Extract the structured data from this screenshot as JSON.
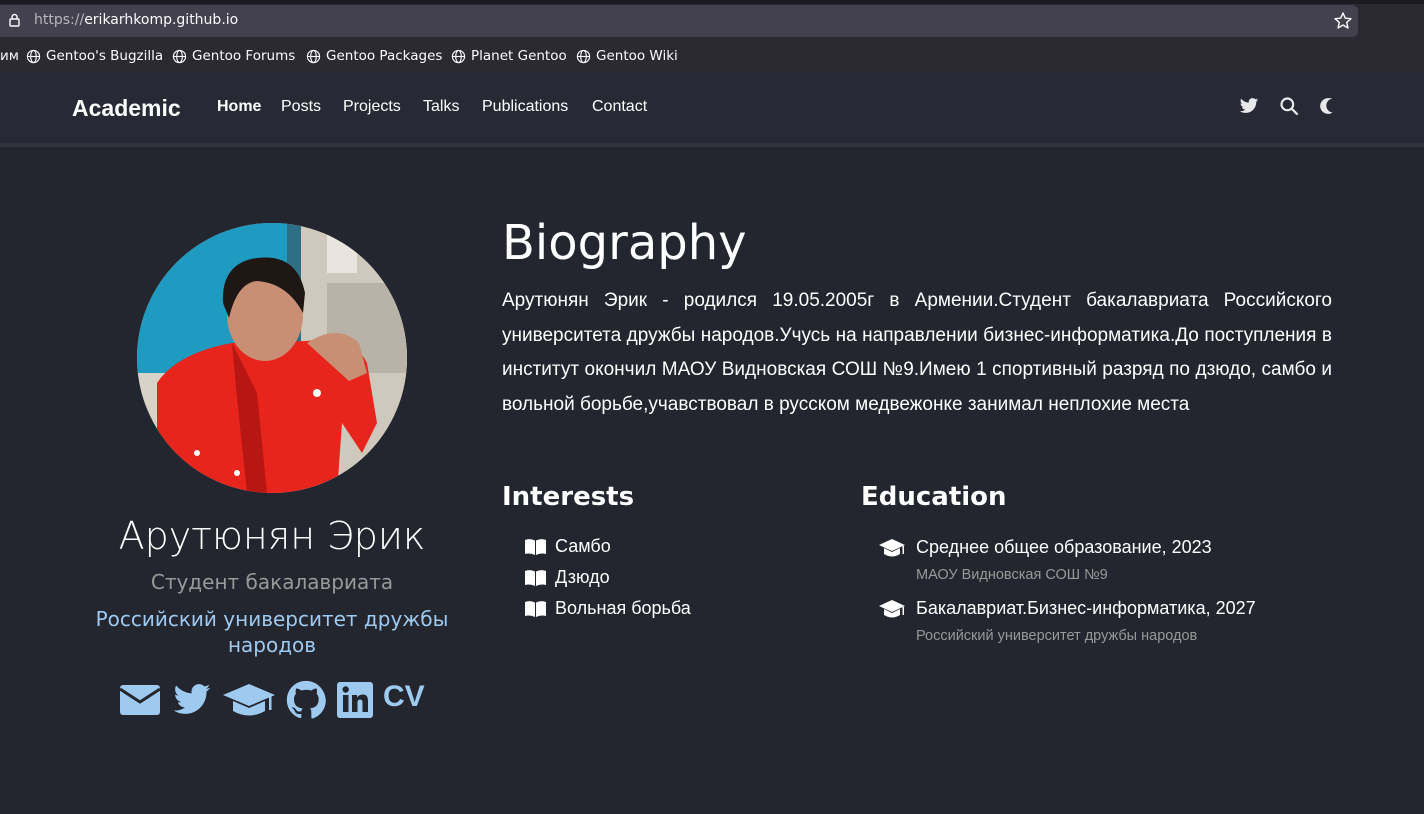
{
  "browser": {
    "url_protocol": "https://",
    "url_host": "erikarhkomp.github.io",
    "bookmarks_partial": "им",
    "bookmarks": [
      "Gentoo's Bugzilla",
      "Gentoo Forums",
      "Gentoo Packages",
      "Planet Gentoo",
      "Gentoo Wiki"
    ]
  },
  "nav": {
    "brand": "Academic",
    "links": [
      "Home",
      "Posts",
      "Projects",
      "Talks",
      "Publications",
      "Contact"
    ],
    "active": "Home"
  },
  "profile": {
    "name": "Арутюнян Эрик",
    "role": "Студент бакалавриата",
    "organization": "Российский университет дружбы народов",
    "cv_label": "CV"
  },
  "biography": {
    "title": "Biography",
    "text": "Арутюнян Эрик - родился 19.05.2005г в Армении.Студент бакалавриата Российского университета дружбы народов.Учусь на направлении бизнес-информатика.До поступления в институт окончил МАОУ Видновская СОШ №9.Имею 1 спортивный разряд по дзюдо, самбо и вольной борьбе,учавствовал в русском медвежонке занимал неплохие места"
  },
  "interests": {
    "title": "Interests",
    "items": [
      "Самбо",
      "Дзюдо",
      "Вольная борьба"
    ]
  },
  "education": {
    "title": "Education",
    "items": [
      {
        "course": "Среднее общее образование, 2023",
        "institution": "МАОУ Видновская СОШ №9"
      },
      {
        "course": "Бакалавриат.Бизнес-информатика, 2027",
        "institution": "Российский университет дружбы народов"
      }
    ]
  },
  "colors": {
    "page_bg": "#23262f",
    "navbar_bg": "#272a35",
    "accent_link": "#9fcaf0",
    "muted_text": "#999999"
  }
}
